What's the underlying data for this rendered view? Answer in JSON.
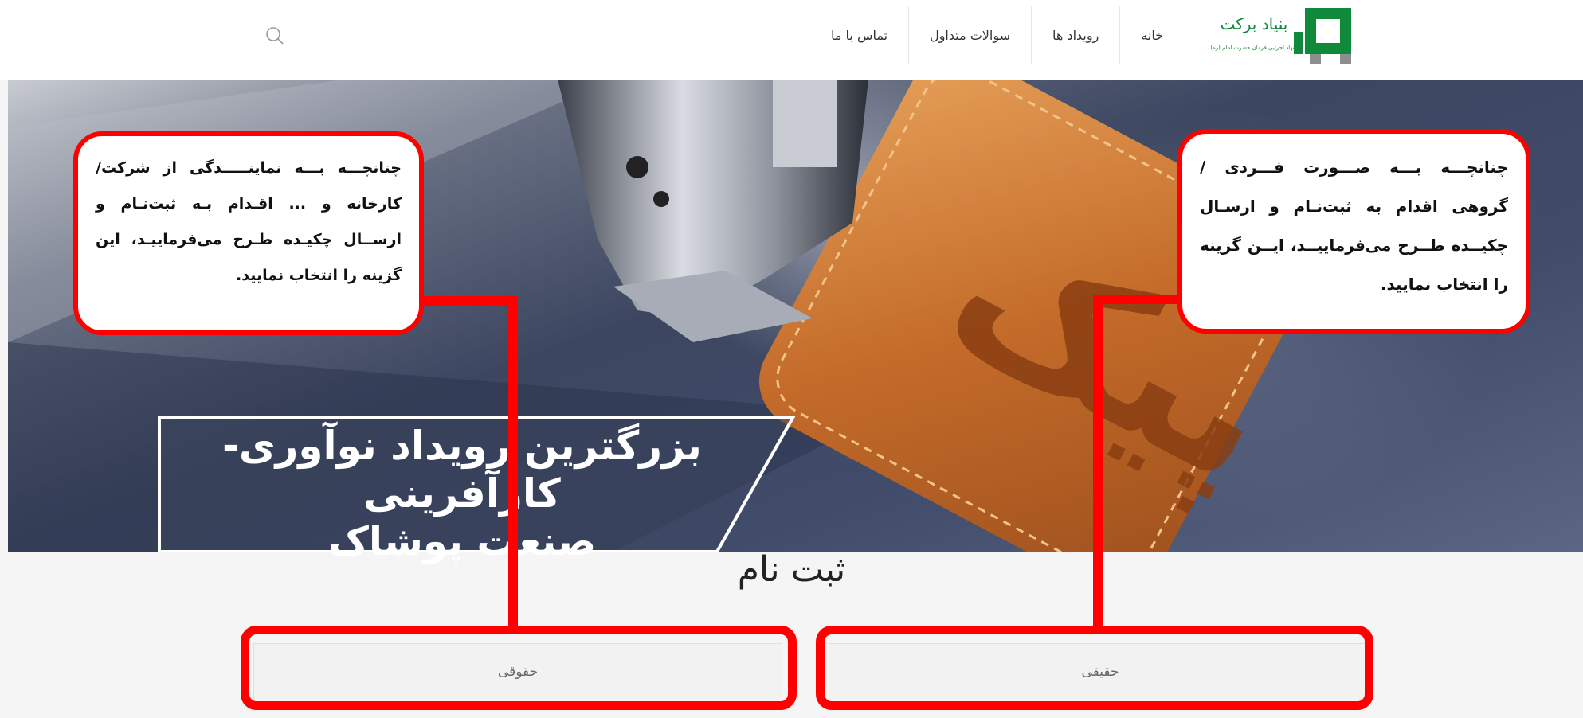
{
  "header": {
    "nav": [
      {
        "label": "تماس با ما"
      },
      {
        "label": "سوالات متداول"
      },
      {
        "label": "رویداد ها"
      },
      {
        "label": "خانه"
      }
    ],
    "logo": {
      "name_line": "بنیاد برکت",
      "sub_line": "نهاد اجرایی فرمان حضرت امام (ره)"
    }
  },
  "hero": {
    "title_line1": "بزرگترین رویداد نوآوری-کارآفرینی",
    "title_line2": "صنعت پوشاک",
    "patch_text": "پیک"
  },
  "registration": {
    "title": "ثبت نام",
    "legal_button": "حقوقی",
    "natural_button": "حقیقی"
  },
  "callouts": {
    "left": "چنانچـــه بـــه نماینـــــدگی از شرکت/کارخانه و ... اقـدام بـه ثبت‌نـام و ارســال چکیـده طـرح می‌فرماییـد، این گزینه را انتخاب نمایید.",
    "right": "چنانچـــه بـــه صـــورت فـــردی / گروهی اقدام به ثبت‌نـام و ارسـال چکیــده طــرح می‌فرماییــد، ایــن گزینه را انتخاب نمایید."
  },
  "colors": {
    "highlight": "#ff0000",
    "logo_green": "#0f8a3a",
    "logo_gray": "#8e8e8e"
  }
}
